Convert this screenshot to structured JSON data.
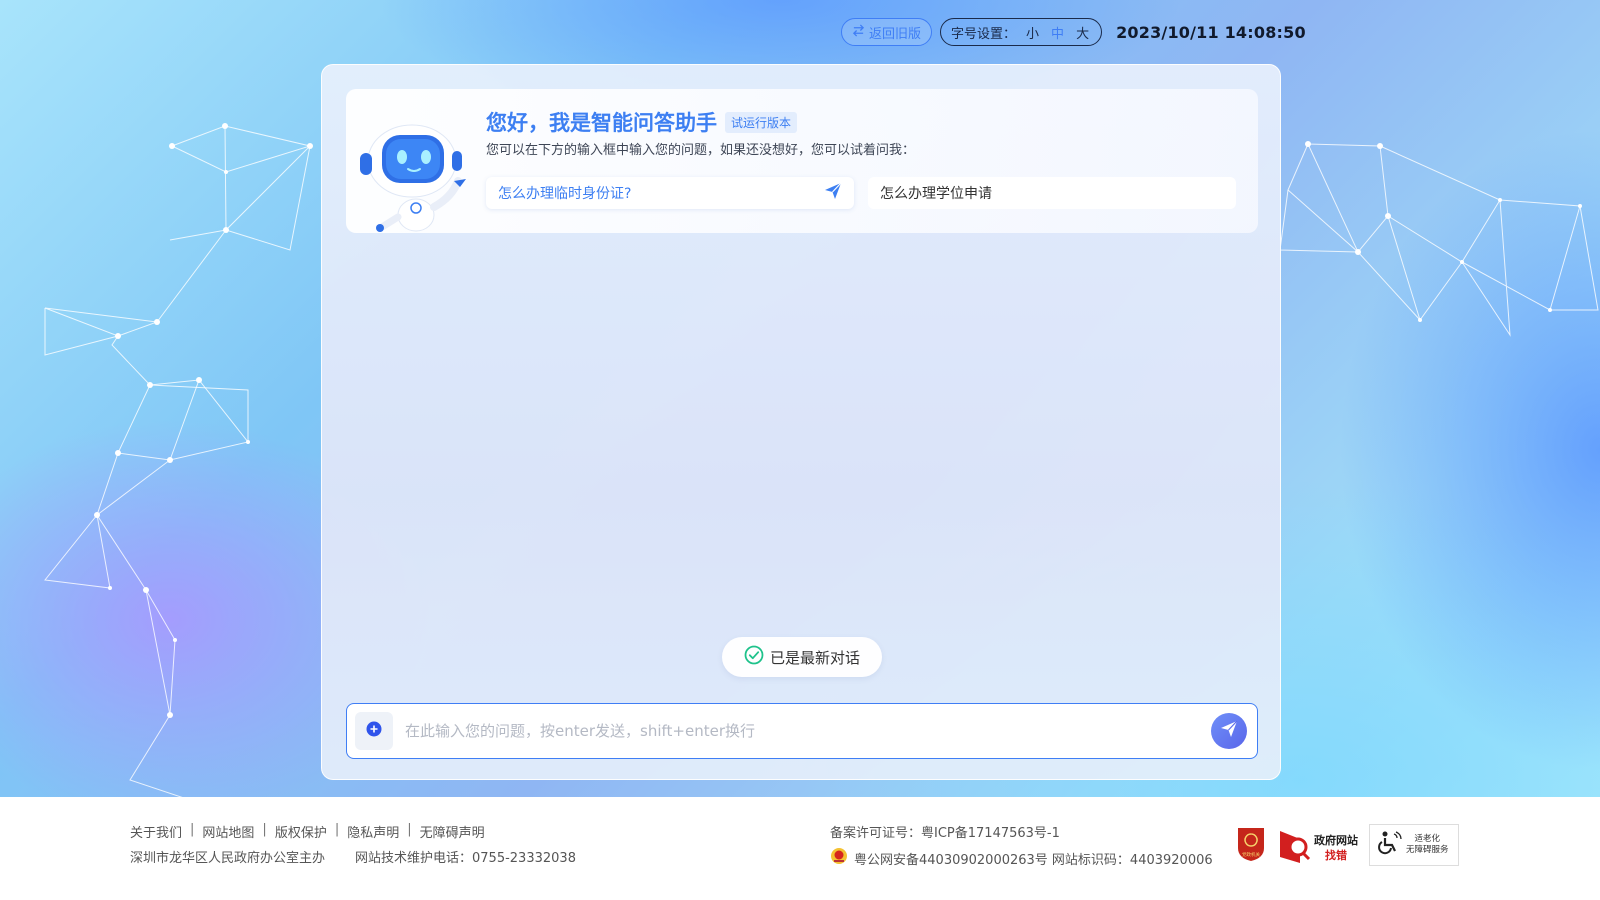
{
  "topbar": {
    "old_version_label": "返回旧版",
    "font_setting_label": "字号设置：",
    "font_options": [
      "小",
      "中",
      "大"
    ],
    "font_selected": "中",
    "datetime": "2023/10/11 14:08:50"
  },
  "welcome": {
    "title": "您好，我是智能问答助手",
    "badge": "试运行版本",
    "subtitle": "您可以在下方的输入框中输入您的问题，如果还没想好，您可以试着问我：",
    "suggestions": [
      "怎么办理临时身份证?",
      "怎么办理学位申请"
    ]
  },
  "chat": {
    "status": "已是最新对话"
  },
  "input": {
    "placeholder": "在此输入您的问题，按enter发送，shift+enter换行",
    "value": ""
  },
  "footer": {
    "links": [
      "关于我们",
      "网站地图",
      "版权保护",
      "隐私声明",
      "无障碍声明"
    ],
    "sponsor": "深圳市龙华区人民政府办公室主办",
    "tech_support": "网站技术维护电话：0755-23332038",
    "icp": "备案许可证号：粤ICP备17147563号-1",
    "gongan": "粤公网安备44030902000263号 网站标识码：4403920006",
    "badge_party": "党政机关",
    "badge_error_title": "政府网站",
    "badge_error_sub": "找错",
    "badge_access_line1": "适老化",
    "badge_access_line2": "无障碍服务"
  },
  "colors": {
    "accent": "#3f7ef5",
    "title_blue": "#3d7ff2",
    "send_gradient_start": "#6f8ff8",
    "send_gradient_end": "#5a66ea",
    "status_green": "#1ec28b"
  }
}
